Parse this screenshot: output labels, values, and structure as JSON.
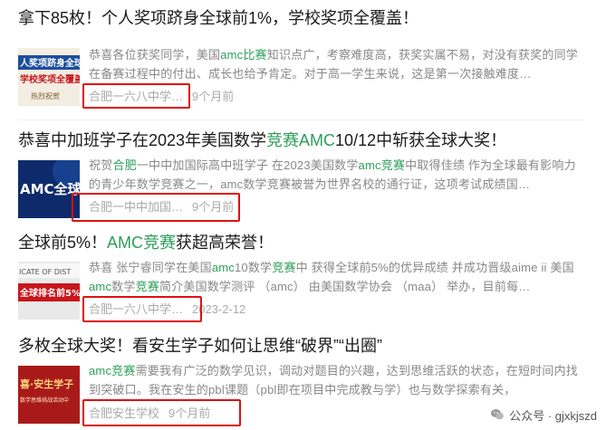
{
  "articles": [
    {
      "title": "拿下85枚！个人奖项跻身全球前1%，学校奖项全覆盖！",
      "summary_parts": [
        {
          "t": "恭喜各位获奖同学，美国",
          "hl": false
        },
        {
          "t": "amc比赛",
          "hl": true
        },
        {
          "t": "知识点广，考察难度高，获奖实属不易，对没有获奖的同学在备赛过程中的付出、成长也给予肯定。对于高一学生来说，这是第一次接触难度…",
          "hl": false
        }
      ],
      "source": "合肥一六八中学…",
      "time": "9个月前",
      "thumb": {
        "caption_top": "人奖项跻身全球前",
        "caption_mid": "学校奖项全覆盖",
        "caption_bot": "热烈祝贺",
        "colors": [
          "#f3ede2",
          "#1d4e9e",
          "#c8151b"
        ]
      }
    },
    {
      "title_parts": [
        {
          "t": "恭喜中加班学子在2023年美国数学",
          "hl": false
        },
        {
          "t": "竞赛AMC",
          "hl": true
        },
        {
          "t": "10/12中斩获全球大奖！",
          "hl": false
        }
      ],
      "summary_parts": [
        {
          "t": "祝贺",
          "hl": false
        },
        {
          "t": "合肥",
          "hl": true
        },
        {
          "t": "一中中加国际高中班学子 在2023美国数学",
          "hl": false
        },
        {
          "t": "amc竞赛",
          "hl": true
        },
        {
          "t": "中取得佳绩 作为全球最有影响力的青少年数学竞赛之一，amc数学竞赛被誉为世界名校的通行证，这项考试成绩国…",
          "hl": false
        }
      ],
      "source": "合肥一中中加国…",
      "time": "9个月前",
      "thumb": {
        "caption": "AMC全球",
        "colors": [
          "#0d2b6b",
          "#ffffff"
        ]
      }
    },
    {
      "title_parts": [
        {
          "t": "全球前5%！",
          "hl": false
        },
        {
          "t": "AMC竞赛",
          "hl": true
        },
        {
          "t": "获超高荣誉！",
          "hl": false
        }
      ],
      "summary_parts": [
        {
          "t": "恭喜 张宁睿同学在美国",
          "hl": false
        },
        {
          "t": "amc",
          "hl": true
        },
        {
          "t": "10数学",
          "hl": false
        },
        {
          "t": "竞赛",
          "hl": true
        },
        {
          "t": "中 获得全球前5%的优异成绩 并成功晋级aime ii 美国",
          "hl": false
        },
        {
          "t": "amc",
          "hl": true
        },
        {
          "t": "数学",
          "hl": false
        },
        {
          "t": "竞赛",
          "hl": true
        },
        {
          "t": "简介美国数学测评 （amc） 由美国数学协会 （maa） 举办，目前每…",
          "hl": false
        }
      ],
      "source": "合肥一六八中学…",
      "time": "2023-2-12",
      "thumb": {
        "caption_top": "ICATE OF DIST",
        "caption_mid": "全球排名前5%！",
        "colors": [
          "#e9e9e9",
          "#c8151b"
        ]
      }
    },
    {
      "title": "多枚全球大奖！看安生学子如何让思维“破界”“出圈”",
      "summary_parts": [
        {
          "t": "amc竞赛",
          "hl": true
        },
        {
          "t": "需要我有广泛的数学见识，调动对题目的兴趣，达到思维活跃的状态，在短时间内找到突破口。我在安生的pbl课题（pbl即在项目中完成教与学）也与数学探索有关，",
          "hl": false
        }
      ],
      "source": "合肥安生学校",
      "time": "9个月前",
      "thumb": {
        "caption_top": "喜·安生学子",
        "caption_bot": "数学思维挑战活动中",
        "colors": [
          "#a81a1a",
          "#ffd27a"
        ]
      }
    }
  ],
  "watermark": {
    "label": "公众号 · gjxkjszd",
    "icon": "wechat-icon"
  },
  "colors": {
    "highlight": "#2e9e5a",
    "annotation": "#e01010",
    "meta": "#aaaaaa",
    "summary": "#888888"
  }
}
